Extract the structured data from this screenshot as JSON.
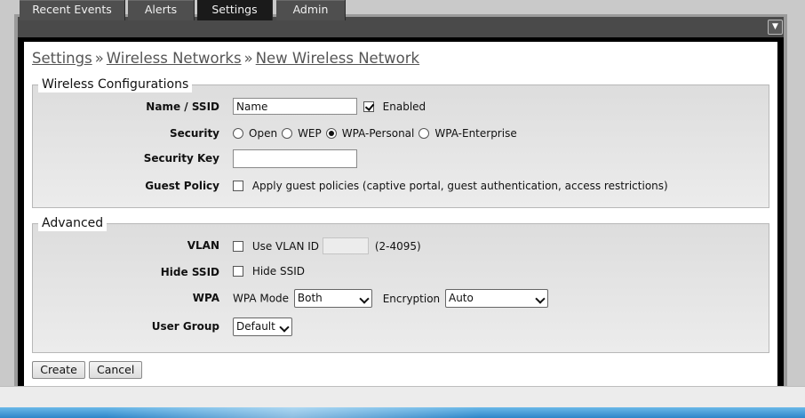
{
  "tabs": [
    {
      "label": "Recent Events",
      "active": false
    },
    {
      "label": "Alerts",
      "active": false
    },
    {
      "label": "Settings",
      "active": true
    },
    {
      "label": "Admin",
      "active": false
    }
  ],
  "breadcrumb": {
    "items": [
      "Settings",
      "Wireless Networks",
      "New Wireless Network"
    ],
    "separator": "»"
  },
  "wireless": {
    "legend": "Wireless Configurations",
    "name_ssid": {
      "label": "Name / SSID",
      "value": "Name",
      "enabled_label": "Enabled",
      "enabled": true
    },
    "security": {
      "label": "Security",
      "options": [
        "Open",
        "WEP",
        "WPA-Personal",
        "WPA-Enterprise"
      ],
      "selected": "WPA-Personal"
    },
    "security_key": {
      "label": "Security Key",
      "value": ""
    },
    "guest_policy": {
      "label": "Guest Policy",
      "checkbox_label": "Apply guest policies (captive portal, guest authentication, access restrictions)",
      "checked": false
    }
  },
  "advanced": {
    "legend": "Advanced",
    "vlan": {
      "label": "VLAN",
      "checkbox_label": "Use VLAN ID",
      "checked": false,
      "value": "",
      "range_hint": "(2-4095)"
    },
    "hide_ssid": {
      "label": "Hide SSID",
      "checkbox_label": "Hide SSID",
      "checked": false
    },
    "wpa": {
      "label": "WPA",
      "mode_label": "WPA Mode",
      "mode_value": "Both",
      "encryption_label": "Encryption",
      "encryption_value": "Auto"
    },
    "user_group": {
      "label": "User Group",
      "value": "Default"
    }
  },
  "buttons": {
    "create": "Create",
    "cancel": "Cancel"
  },
  "colors": {
    "tab_active": "#1a1a1a",
    "tab_inactive": "#4f4f4f",
    "link": "#555555"
  }
}
